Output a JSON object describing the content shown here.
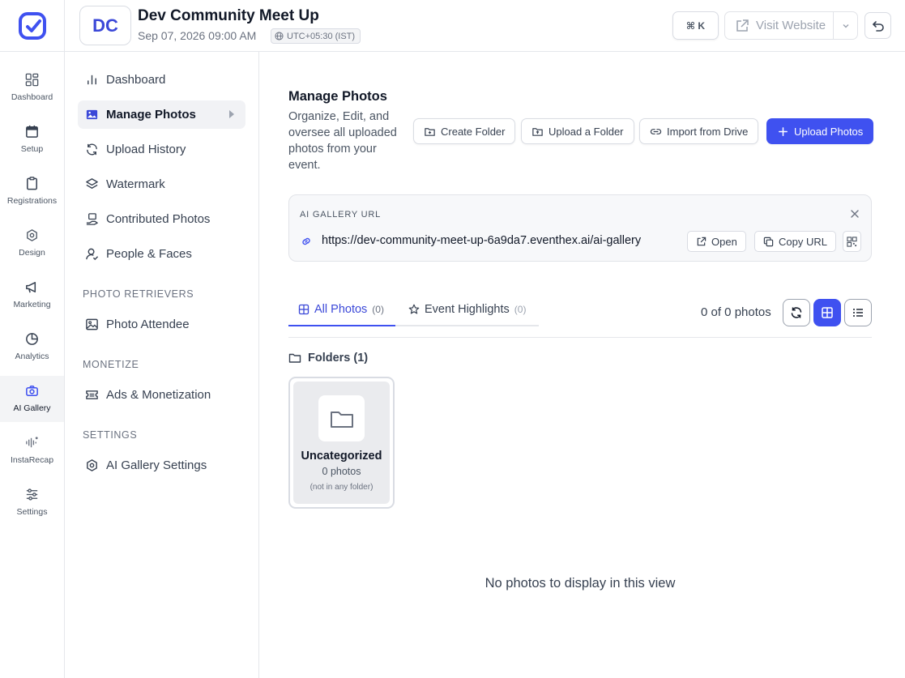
{
  "header": {
    "event_initials": "DC",
    "event_title": "Dev Community Meet Up",
    "event_datetime": "Sep 07, 2026 09:00 AM",
    "timezone": "UTC+05:30 (IST)",
    "command_shortcut": "⌘ K",
    "visit_website_label": "Visit Website"
  },
  "rail": {
    "items": [
      {
        "label": "Dashboard",
        "icon": "grid-icon"
      },
      {
        "label": "Setup",
        "icon": "calendar-icon"
      },
      {
        "label": "Registrations",
        "icon": "clipboard-icon"
      },
      {
        "label": "Design",
        "icon": "hexagon-icon"
      },
      {
        "label": "Marketing",
        "icon": "megaphone-icon"
      },
      {
        "label": "Analytics",
        "icon": "pie-chart-icon"
      },
      {
        "label": "AI Gallery",
        "icon": "camera-icon",
        "active": true
      },
      {
        "label": "InstaRecap",
        "icon": "waveform-icon"
      },
      {
        "label": "Settings",
        "icon": "sliders-icon"
      }
    ]
  },
  "sidebar": {
    "items": [
      {
        "label": "Dashboard",
        "icon": "bar-chart-icon"
      },
      {
        "label": "Manage Photos",
        "icon": "image-icon",
        "active": true
      },
      {
        "label": "Upload History",
        "icon": "refresh-icon"
      },
      {
        "label": "Watermark",
        "icon": "layers-icon"
      },
      {
        "label": "Contributed Photos",
        "icon": "hand-photo-icon"
      },
      {
        "label": "People & Faces",
        "icon": "user-check-icon"
      }
    ],
    "section_retrievers": "PHOTO RETRIEVERS",
    "photo_attendee": "Photo Attendee",
    "section_monetize": "MONETIZE",
    "ads_monetization": "Ads & Monetization",
    "section_settings": "SETTINGS",
    "ai_gallery_settings": "AI Gallery Settings"
  },
  "main": {
    "title": "Manage Photos",
    "description": "Organize, Edit, and oversee all uploaded photos from your event.",
    "buttons": {
      "create_folder": "Create Folder",
      "upload_folder": "Upload a Folder",
      "import_drive": "Import from Drive",
      "upload_photos": "Upload Photos"
    },
    "gallery_url": {
      "label": "AI GALLERY URL",
      "url": "https://dev-community-meet-up-6a9da7.eventhex.ai/ai-gallery",
      "open_label": "Open",
      "copy_label": "Copy URL"
    },
    "tabs": [
      {
        "label": "All Photos",
        "count": "(0)",
        "active": true
      },
      {
        "label": "Event Highlights",
        "count": "(0)"
      }
    ],
    "photo_count": "0 of 0 photos",
    "folders_heading": "Folders (1)",
    "folder": {
      "name": "Uncategorized",
      "count": "0 photos",
      "note": "(not in any folder)"
    },
    "empty_message": "No photos to display in this view"
  },
  "colors": {
    "accent": "#3f51f0",
    "brand": "#3b48d8"
  }
}
